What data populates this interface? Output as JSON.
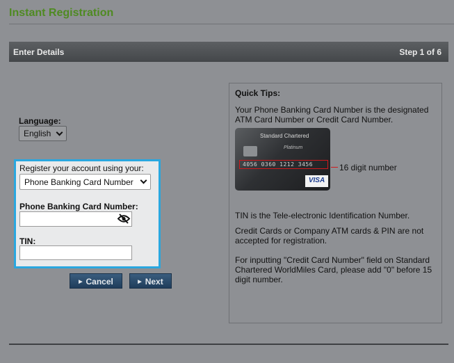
{
  "page": {
    "title": "Instant Registration"
  },
  "panel": {
    "header_left": "Enter Details",
    "header_right": "Step 1 of 6"
  },
  "language": {
    "label": "Language:",
    "selected": "English"
  },
  "registration": {
    "method_label": "Register your account using your:",
    "method_selected": "Phone Banking Card Number",
    "card_label": "Phone Banking Card Number:",
    "card_value": "",
    "tin_label": "TIN:",
    "tin_value": ""
  },
  "buttons": {
    "cancel": "Cancel",
    "next": "Next"
  },
  "tips": {
    "title": "Quick Tips:",
    "tip1": "Your Phone Banking Card Number is the designated ATM Card Number or Credit Card Number.",
    "card_callout": "16 digit number",
    "tip2": "TIN is the Tele-electronic Identification Number.",
    "tip3": "Credit Cards or Company ATM cards & PIN are not accepted for registration.",
    "tip4": "For inputting \"Credit Card Number\" field on Standard Chartered WorldMiles Card, please add \"0\" before 15 digit number.",
    "card_image": {
      "bank_name": "Standard Chartered",
      "card_tier": "Platinum",
      "card_number": "4056 0360 1212 3456",
      "brand": "VISA"
    }
  },
  "colors": {
    "title_green": "#4f8a22",
    "highlight_blue": "#2aa7df",
    "button_navy": "#1f3d5b",
    "card_callout_red": "#d0191c"
  },
  "icons": {
    "password_toggle": "eye-slash-icon",
    "dropdown": "chevron-down-icon",
    "button_arrow": "triangle-right-icon"
  }
}
